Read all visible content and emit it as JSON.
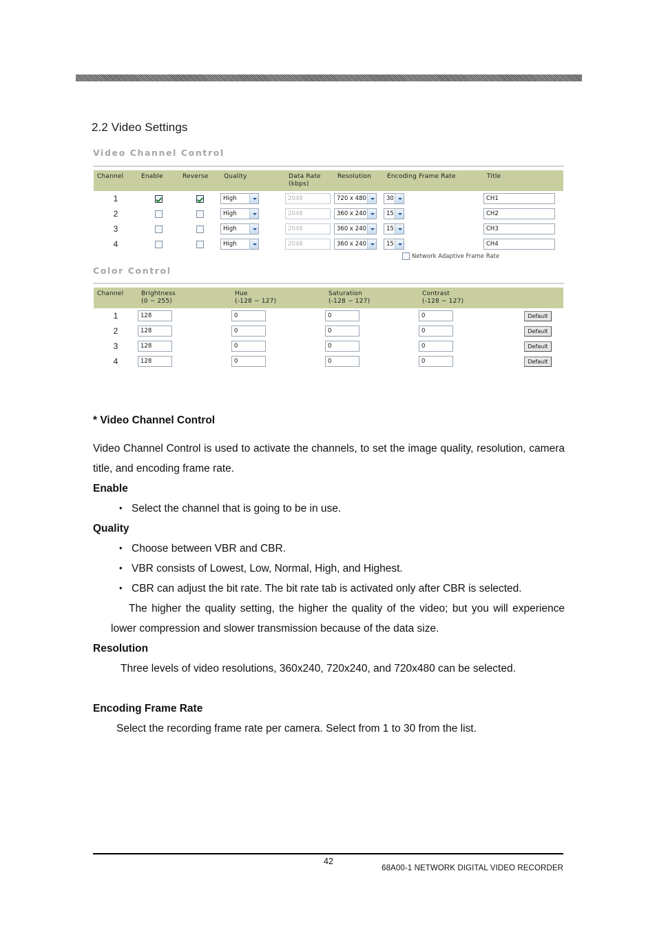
{
  "document": {
    "heading": "2.2 Video Settings"
  },
  "video_channel_control": {
    "panel_title": "Video Channel Control",
    "columns": [
      "Channel",
      "Enable",
      "Reverse",
      "Quality",
      "Data Rate (kbps)",
      "Resolution",
      "Encoding Frame Rate",
      "Title"
    ],
    "column_data_rate_line1": "Data Rate",
    "column_data_rate_line2": "(kbps)",
    "rows": [
      {
        "channel": "1",
        "enable": true,
        "reverse": true,
        "quality": "High",
        "data_rate": "2048",
        "resolution": "720 x 480",
        "frame_rate": "30",
        "title": "CH1"
      },
      {
        "channel": "2",
        "enable": false,
        "reverse": false,
        "quality": "High",
        "data_rate": "2048",
        "resolution": "360 x 240",
        "frame_rate": "15",
        "title": "CH2"
      },
      {
        "channel": "3",
        "enable": false,
        "reverse": false,
        "quality": "High",
        "data_rate": "2048",
        "resolution": "360 x 240",
        "frame_rate": "15",
        "title": "CH3"
      },
      {
        "channel": "4",
        "enable": false,
        "reverse": false,
        "quality": "High",
        "data_rate": "2048",
        "resolution": "360 x 240",
        "frame_rate": "15",
        "title": "CH4"
      }
    ],
    "network_adaptive_label": "Network Adaptive Frame Rate",
    "network_adaptive_checked": false
  },
  "color_control": {
    "panel_title": "Color Control",
    "columns": {
      "channel": "Channel",
      "brightness_name": "Brightness",
      "brightness_range": "(0 ~ 255)",
      "hue_name": "Hue",
      "hue_range": "(-128 ~ 127)",
      "saturation_name": "Saturation",
      "saturation_range": "(-128 ~ 127)",
      "contrast_name": "Contrast",
      "contrast_range": "(-128 ~ 127)",
      "action": ""
    },
    "rows": [
      {
        "channel": "1",
        "brightness": "128",
        "hue": "0",
        "saturation": "0",
        "contrast": "0",
        "button": "Default"
      },
      {
        "channel": "2",
        "brightness": "128",
        "hue": "0",
        "saturation": "0",
        "contrast": "0",
        "button": "Default"
      },
      {
        "channel": "3",
        "brightness": "128",
        "hue": "0",
        "saturation": "0",
        "contrast": "0",
        "button": "Default"
      },
      {
        "channel": "4",
        "brightness": "128",
        "hue": "0",
        "saturation": "0",
        "contrast": "0",
        "button": "Default"
      }
    ]
  },
  "body": {
    "section_title": "* Video Channel Control",
    "intro": "Video Channel Control is used to activate the channels, to set the image quality, resolution, camera title, and encoding frame rate.",
    "enable_head": "Enable",
    "enable_bullets": [
      "Select the channel that is going to be in use."
    ],
    "quality_head": "Quality",
    "quality_bullets": [
      "Choose between VBR and CBR.",
      "VBR consists of Lowest, Low, Normal, High, and Highest.",
      "CBR can adjust the bit rate.   The bit rate tab is activated only after CBR is selected."
    ],
    "quality_note": "The higher the quality setting, the higher the quality of the video; but you will experience lower compression and slower transmission because of the data size.",
    "resolution_head": "Resolution",
    "resolution_text": "Three levels of video resolutions, 360x240, 720x240, and 720x480 can be selected.",
    "encoding_head": "Encoding Frame Rate",
    "encoding_text": "Select the recording frame rate per camera.   Select from 1 to 30 from the list."
  },
  "footer": {
    "page_number": "42",
    "note": "68A00-1 NETWORK DIGITAL VIDEO RECORDER"
  },
  "colors": {
    "table_header": "#c9cea0",
    "panel_title": "#a6a6a6",
    "checkbox_border": "#20374f",
    "check_mark": "#1e7a2e",
    "dropdown_arrow": "#1b4f91"
  }
}
